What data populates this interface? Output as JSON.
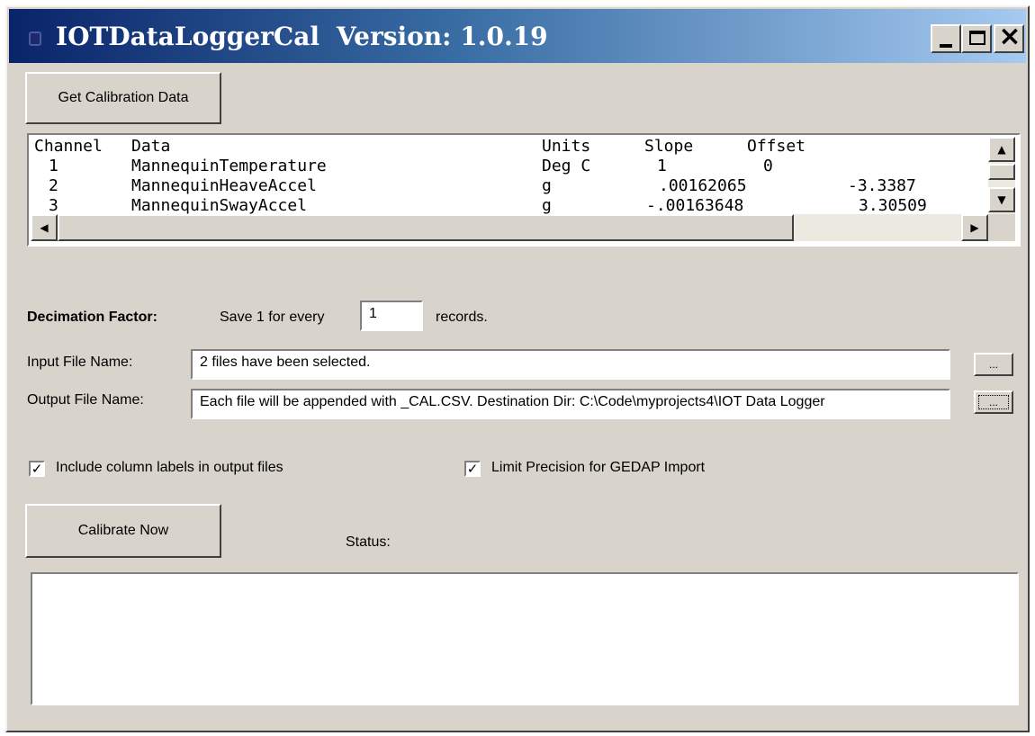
{
  "window": {
    "title_app": "IOTDataLoggerCal",
    "title_version": "Version: 1.0.19",
    "minimize_glyph": "_",
    "close_glyph": "×"
  },
  "get_cal_button": "Get Calibration Data",
  "calibration_list": {
    "header": [
      "Channel",
      "Data",
      "Units",
      "Slope",
      "Offset"
    ],
    "rows": [
      [
        "1",
        "MannequinTemperature",
        "Deg C",
        "1",
        "0"
      ],
      [
        "2",
        "MannequinHeaveAccel",
        "g",
        ".00162065",
        "-3.3387"
      ],
      [
        "3",
        "MannequinSwayAccel",
        "g",
        "-.00163648",
        "3.30509"
      ]
    ],
    "scroll_up": "▲",
    "scroll_down": "▼",
    "scroll_left": "◀",
    "scroll_right": "▶"
  },
  "decimation": {
    "label": "Decimation Factor:",
    "prefix": "Save 1 for every",
    "value": "1",
    "suffix": "records."
  },
  "input_file": {
    "label": "Input File Name:",
    "value": "2 files have been selected.",
    "browse_label": "..."
  },
  "output_file": {
    "label": "Output File Name:",
    "value": "Each file will be appended with _CAL.CSV.   Destination Dir: C:\\Code\\myprojects4\\IOT Data Logger",
    "browse_label": "..."
  },
  "options": {
    "include_labels": {
      "label": "Include column labels in output files",
      "checked": true,
      "mark": "✓"
    },
    "limit_precision": {
      "label": "Limit Precision for GEDAP Import",
      "checked": true,
      "mark": "✓"
    }
  },
  "calibrate_button": "Calibrate Now",
  "status_label": "Status:",
  "status_text": "",
  "colors": {
    "title_gradient_start": "#0a246a",
    "title_gradient_end": "#a6caf0",
    "face": "#d8d4cc"
  }
}
